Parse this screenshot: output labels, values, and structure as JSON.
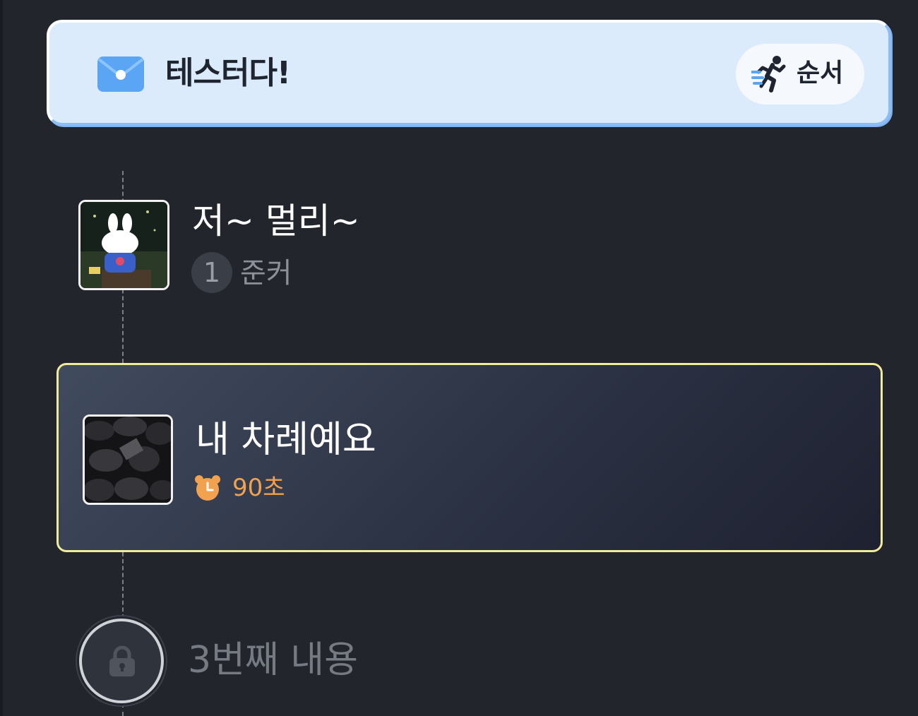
{
  "header": {
    "title": "테스터다!",
    "order_button_label": "순서"
  },
  "items": [
    {
      "title": "저~ 멀리~",
      "order_number": "1",
      "author": "준커"
    },
    {
      "title": "내 차례예요",
      "timer": "90초",
      "state": "active"
    },
    {
      "title": "3번째 내용",
      "state": "locked"
    }
  ],
  "colors": {
    "background": "#22252c",
    "header_bg": "#dcebfb",
    "active_border": "#f0ec9a",
    "timer": "#f2a24e",
    "accent_blue": "#5aa6f5"
  },
  "icons": [
    "mail-icon",
    "running-person-icon",
    "alarm-clock-icon",
    "lock-icon"
  ]
}
